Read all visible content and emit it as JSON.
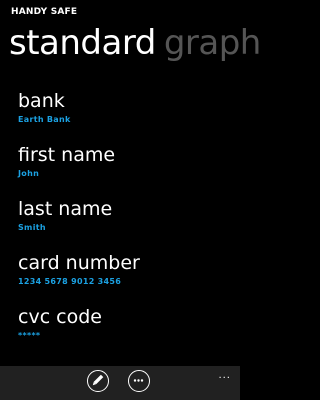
{
  "app": {
    "title": "HANDY SAFE"
  },
  "pivot": {
    "tabs": [
      {
        "label": "standard",
        "active": true
      },
      {
        "label": "graph",
        "active": false
      }
    ]
  },
  "fields": [
    {
      "label": "bank",
      "value": "Earth Bank"
    },
    {
      "label": "first name",
      "value": "John"
    },
    {
      "label": "last name",
      "value": "Smith"
    },
    {
      "label": "card number",
      "value": "1234 5678 9012 3456"
    },
    {
      "label": "cvc code",
      "value": "*****"
    }
  ],
  "app_bar": {
    "buttons": [
      {
        "icon": "edit-icon"
      },
      {
        "icon": "more-icon"
      }
    ],
    "menu": "..."
  },
  "colors": {
    "accent": "#1ba1e2",
    "background": "#000000",
    "app_bar": "#212121",
    "inactive_header": "#555555"
  }
}
